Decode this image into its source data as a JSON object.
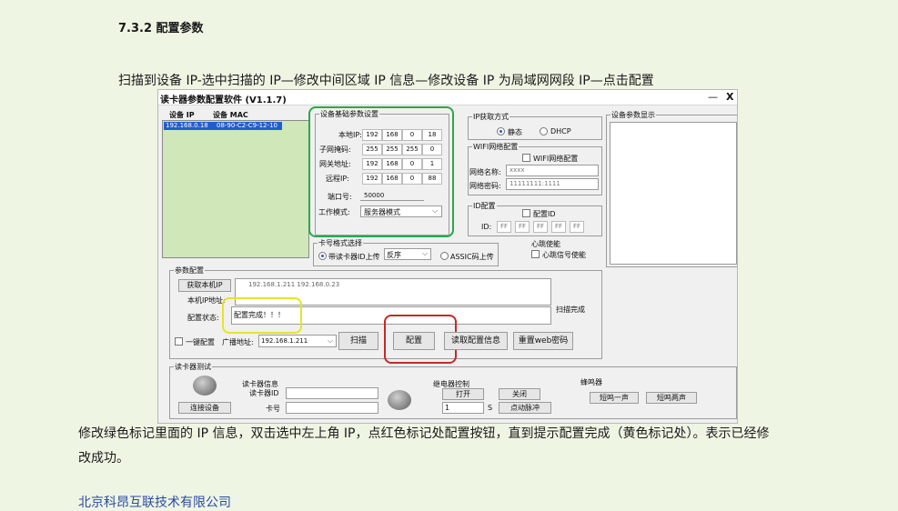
{
  "heading": "7.3.2 配置参数",
  "intro": "扫描到设备 IP-选中扫描的 IP—修改中间区域 IP 信息—修改设备 IP 为局域网网段 IP—点击配置",
  "para1": "修改绿色标记里面的 IP 信息，双击选中左上角 IP，点红色标记处配置按钮，直到提示配置完成（黄色标记处）。表示已经修",
  "para2": "改成功。",
  "footer": "北京科昂互联技术有限公司",
  "app": {
    "title": "读卡器参数配置软件 (V1.1.7)",
    "minimize": "—",
    "close": "X",
    "device_list": {
      "col_ip": "设备 IP",
      "col_mac": "设备 MAC",
      "rows": [
        {
          "ip": "192.168.0.18",
          "mac": "08-90-C2-C9-12-10"
        }
      ]
    },
    "basic": {
      "title": "设备基础参数设置",
      "local_ip_label": "本地IP:",
      "local_ip": [
        "192",
        "168",
        "0",
        "18"
      ],
      "mask_label": "子网掩码:",
      "mask": [
        "255",
        "255",
        "255",
        "0"
      ],
      "gateway_label": "网关地址:",
      "gateway": [
        "192",
        "168",
        "0",
        "1"
      ],
      "remote_ip_label": "远程IP:",
      "remote_ip": [
        "192",
        "168",
        "0",
        "88"
      ],
      "port_label": "端口号:",
      "port": "50000",
      "mode_label": "工作模式:",
      "mode": "服务器模式"
    },
    "ip_method": {
      "title": "IP获取方式",
      "static": "静态",
      "dhcp": "DHCP"
    },
    "wifi": {
      "title": "WIFI网络配置",
      "checkbox": "WIFI网络配置",
      "ssid_label": "网络名称:",
      "ssid": "xxxx",
      "pwd_label": "网络密码:",
      "pwd": "11111111:1111"
    },
    "id_cfg": {
      "title": "ID配置",
      "checkbox": "配置ID",
      "id_label": "ID:",
      "id": [
        "FF",
        "FF",
        "FF",
        "FF",
        "FF"
      ]
    },
    "display_title": "设备参数显示",
    "card_format": {
      "title": "卡号格式选择",
      "with_id": "带读卡器ID上传",
      "order": "反序",
      "ascii": "ASSIC码上传"
    },
    "heartbeat": {
      "title": "心跳使能",
      "checkbox": "心跳信号使能"
    },
    "params": {
      "title": "参数配置",
      "get_local_ip": "获取本机IP",
      "local_ip_label": "本机IP地址:",
      "ip_list": "192.168.1.211    192.168.0.23",
      "status_label": "配置状态:",
      "status_value": "配置完成！！！",
      "scan_done": "扫描完成",
      "one_key": "一键配置",
      "broadcast_label": "广播地址:",
      "broadcast": "192.168.1.211",
      "scan": "扫描",
      "configure": "配置",
      "read_config": "读取配置信息",
      "reset_web": "重置web密码"
    },
    "test": {
      "title": "读卡器测试",
      "connect": "连接设备",
      "reader_info": "读卡器信息",
      "reader_id_label": "读卡器ID",
      "card_label": "卡号",
      "relay": "继电器控制",
      "open": "打开",
      "close_btn": "关闭",
      "relay_num": "1",
      "relay_unit": "S",
      "jog": "点动脉冲",
      "buzzer": "蜂鸣器",
      "beep_once": "短鸣一声",
      "beep_twice": "短鸣两声"
    }
  },
  "colors": {
    "green_mark": "#2aa84a",
    "red_mark": "#c42a2a",
    "yellow_mark": "#e6e32b",
    "selection": "#1e5fd0"
  }
}
